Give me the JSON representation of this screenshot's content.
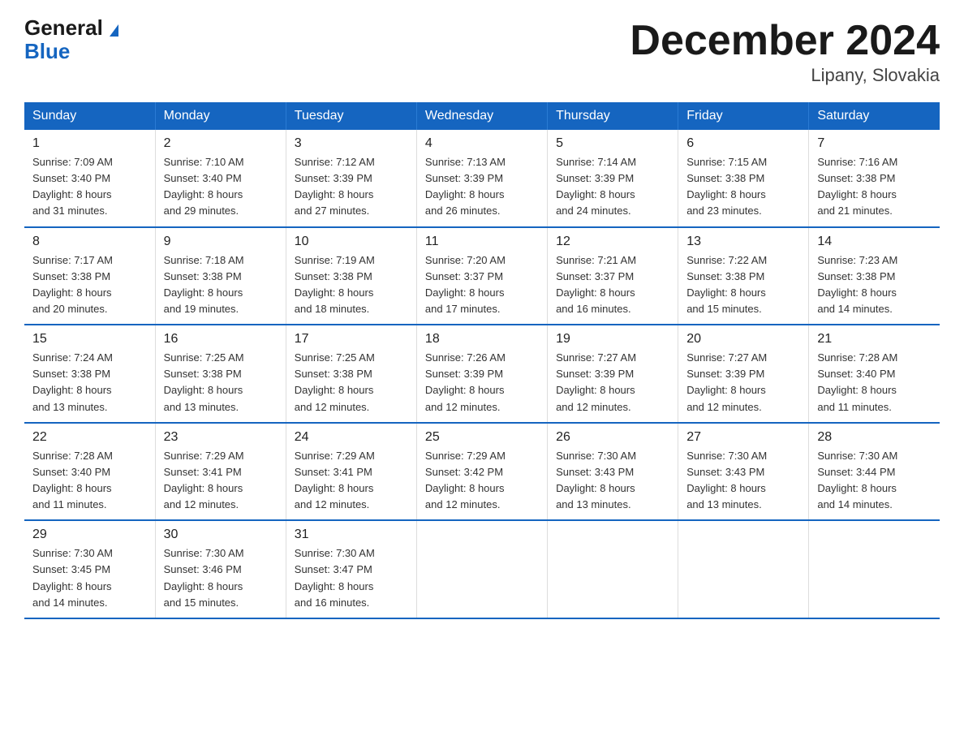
{
  "header": {
    "logo_line1": "General",
    "logo_line2": "Blue",
    "main_title": "December 2024",
    "subtitle": "Lipany, Slovakia"
  },
  "days_of_week": [
    "Sunday",
    "Monday",
    "Tuesday",
    "Wednesday",
    "Thursday",
    "Friday",
    "Saturday"
  ],
  "weeks": [
    [
      {
        "day": "1",
        "sunrise": "7:09 AM",
        "sunset": "3:40 PM",
        "daylight": "8 hours and 31 minutes."
      },
      {
        "day": "2",
        "sunrise": "7:10 AM",
        "sunset": "3:40 PM",
        "daylight": "8 hours and 29 minutes."
      },
      {
        "day": "3",
        "sunrise": "7:12 AM",
        "sunset": "3:39 PM",
        "daylight": "8 hours and 27 minutes."
      },
      {
        "day": "4",
        "sunrise": "7:13 AM",
        "sunset": "3:39 PM",
        "daylight": "8 hours and 26 minutes."
      },
      {
        "day": "5",
        "sunrise": "7:14 AM",
        "sunset": "3:39 PM",
        "daylight": "8 hours and 24 minutes."
      },
      {
        "day": "6",
        "sunrise": "7:15 AM",
        "sunset": "3:38 PM",
        "daylight": "8 hours and 23 minutes."
      },
      {
        "day": "7",
        "sunrise": "7:16 AM",
        "sunset": "3:38 PM",
        "daylight": "8 hours and 21 minutes."
      }
    ],
    [
      {
        "day": "8",
        "sunrise": "7:17 AM",
        "sunset": "3:38 PM",
        "daylight": "8 hours and 20 minutes."
      },
      {
        "day": "9",
        "sunrise": "7:18 AM",
        "sunset": "3:38 PM",
        "daylight": "8 hours and 19 minutes."
      },
      {
        "day": "10",
        "sunrise": "7:19 AM",
        "sunset": "3:38 PM",
        "daylight": "8 hours and 18 minutes."
      },
      {
        "day": "11",
        "sunrise": "7:20 AM",
        "sunset": "3:37 PM",
        "daylight": "8 hours and 17 minutes."
      },
      {
        "day": "12",
        "sunrise": "7:21 AM",
        "sunset": "3:37 PM",
        "daylight": "8 hours and 16 minutes."
      },
      {
        "day": "13",
        "sunrise": "7:22 AM",
        "sunset": "3:38 PM",
        "daylight": "8 hours and 15 minutes."
      },
      {
        "day": "14",
        "sunrise": "7:23 AM",
        "sunset": "3:38 PM",
        "daylight": "8 hours and 14 minutes."
      }
    ],
    [
      {
        "day": "15",
        "sunrise": "7:24 AM",
        "sunset": "3:38 PM",
        "daylight": "8 hours and 13 minutes."
      },
      {
        "day": "16",
        "sunrise": "7:25 AM",
        "sunset": "3:38 PM",
        "daylight": "8 hours and 13 minutes."
      },
      {
        "day": "17",
        "sunrise": "7:25 AM",
        "sunset": "3:38 PM",
        "daylight": "8 hours and 12 minutes."
      },
      {
        "day": "18",
        "sunrise": "7:26 AM",
        "sunset": "3:39 PM",
        "daylight": "8 hours and 12 minutes."
      },
      {
        "day": "19",
        "sunrise": "7:27 AM",
        "sunset": "3:39 PM",
        "daylight": "8 hours and 12 minutes."
      },
      {
        "day": "20",
        "sunrise": "7:27 AM",
        "sunset": "3:39 PM",
        "daylight": "8 hours and 12 minutes."
      },
      {
        "day": "21",
        "sunrise": "7:28 AM",
        "sunset": "3:40 PM",
        "daylight": "8 hours and 11 minutes."
      }
    ],
    [
      {
        "day": "22",
        "sunrise": "7:28 AM",
        "sunset": "3:40 PM",
        "daylight": "8 hours and 11 minutes."
      },
      {
        "day": "23",
        "sunrise": "7:29 AM",
        "sunset": "3:41 PM",
        "daylight": "8 hours and 12 minutes."
      },
      {
        "day": "24",
        "sunrise": "7:29 AM",
        "sunset": "3:41 PM",
        "daylight": "8 hours and 12 minutes."
      },
      {
        "day": "25",
        "sunrise": "7:29 AM",
        "sunset": "3:42 PM",
        "daylight": "8 hours and 12 minutes."
      },
      {
        "day": "26",
        "sunrise": "7:30 AM",
        "sunset": "3:43 PM",
        "daylight": "8 hours and 13 minutes."
      },
      {
        "day": "27",
        "sunrise": "7:30 AM",
        "sunset": "3:43 PM",
        "daylight": "8 hours and 13 minutes."
      },
      {
        "day": "28",
        "sunrise": "7:30 AM",
        "sunset": "3:44 PM",
        "daylight": "8 hours and 14 minutes."
      }
    ],
    [
      {
        "day": "29",
        "sunrise": "7:30 AM",
        "sunset": "3:45 PM",
        "daylight": "8 hours and 14 minutes."
      },
      {
        "day": "30",
        "sunrise": "7:30 AM",
        "sunset": "3:46 PM",
        "daylight": "8 hours and 15 minutes."
      },
      {
        "day": "31",
        "sunrise": "7:30 AM",
        "sunset": "3:47 PM",
        "daylight": "8 hours and 16 minutes."
      },
      null,
      null,
      null,
      null
    ]
  ],
  "labels": {
    "sunrise": "Sunrise:",
    "sunset": "Sunset:",
    "daylight": "Daylight:"
  }
}
